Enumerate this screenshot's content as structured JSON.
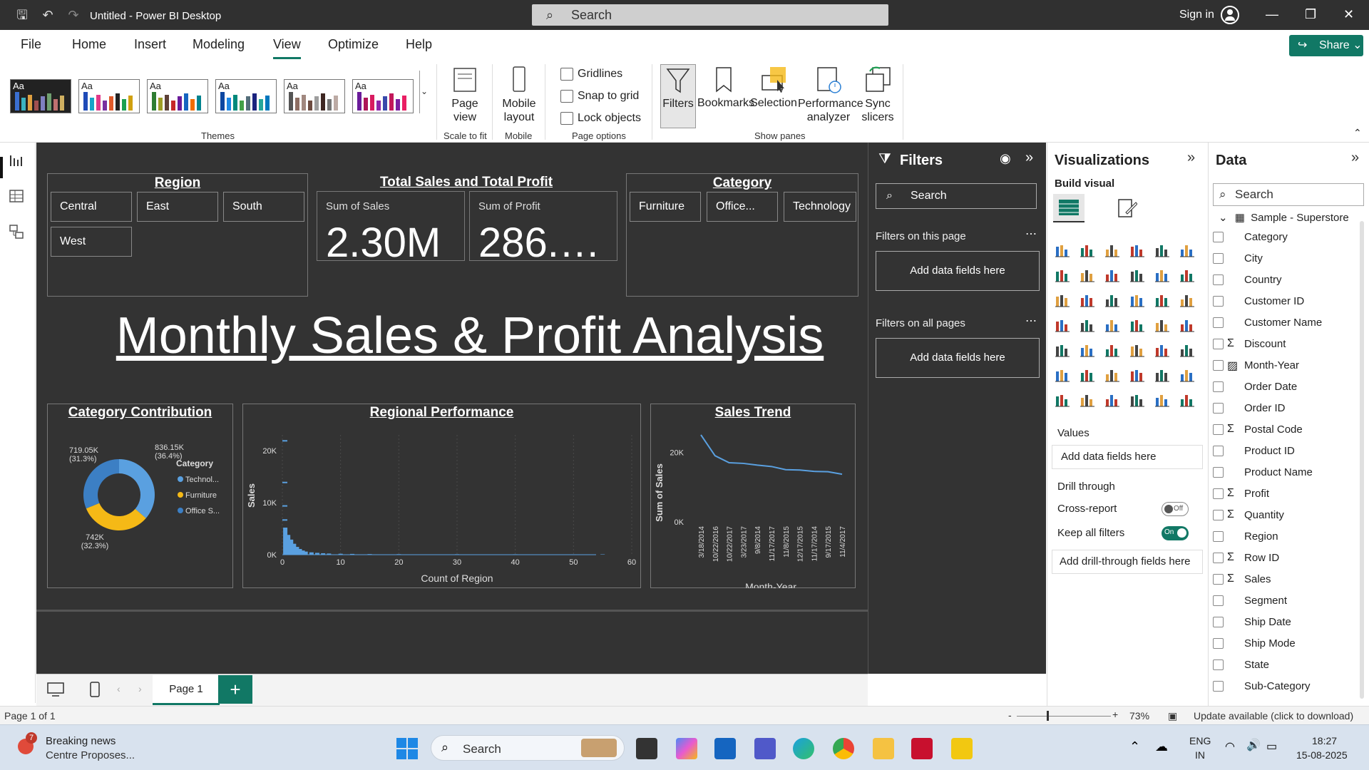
{
  "window": {
    "title": "Untitled - Power BI Desktop",
    "search_placeholder": "Search",
    "signin": "Sign in"
  },
  "menu": {
    "items": [
      "File",
      "Home",
      "Insert",
      "Modeling",
      "View",
      "Optimize",
      "Help"
    ],
    "active": "View",
    "share": "Share"
  },
  "ribbon": {
    "themes_label": "Themes",
    "theme_text": "Aa",
    "page_view": "Page view",
    "scale_label": "Scale to fit",
    "mobile_layout": "Mobile layout",
    "mobile_label": "Mobile",
    "gridlines": "Gridlines",
    "snap": "Snap to grid",
    "lock": "Lock objects",
    "page_options_label": "Page options",
    "filters": "Filters",
    "bookmarks": "Bookmarks",
    "selection": "Selection",
    "performance": "Performance analyzer",
    "sync": "Sync slicers",
    "show_panes_label": "Show panes"
  },
  "report": {
    "region_title": "Region",
    "regions": [
      "Central",
      "East",
      "South",
      "West"
    ],
    "kpi_title": "Total Sales and Total Profit",
    "kpis": [
      {
        "label": "Sum of Sales",
        "value": "2.30M"
      },
      {
        "label": "Sum of Profit",
        "value": "286.…"
      }
    ],
    "category_title": "Category",
    "categories": [
      "Furniture",
      "Office...",
      "Technology"
    ],
    "main_title": "Monthly Sales & Profit Analysis"
  },
  "chart_data": [
    {
      "type": "pie",
      "title": "Category Contribution",
      "legend_title": "Category",
      "legend": [
        "Technol...",
        "Furniture",
        "Office S..."
      ],
      "slices": [
        {
          "name": "Technology",
          "value": 836150,
          "label": "836.15K",
          "pct": "(36.4%)",
          "color": "#5aa0e0"
        },
        {
          "name": "Furniture",
          "value": 742000,
          "label": "742K",
          "pct": "(32.3%)",
          "color": "#f5b916"
        },
        {
          "name": "Office Supplies",
          "value": 719050,
          "label": "719.05K",
          "pct": "(31.3%)",
          "color": "#3c7fc4"
        }
      ]
    },
    {
      "type": "bar",
      "title": "Regional Performance",
      "xlabel": "Count of Region",
      "ylabel": "Sales",
      "xlim": [
        0,
        60
      ],
      "ylim": [
        0,
        23000
      ],
      "x_ticks": [
        "0",
        "10",
        "20",
        "30",
        "40",
        "50",
        "60"
      ],
      "y_ticks": [
        "0K",
        "10K",
        "20K"
      ],
      "x": [
        0.5,
        1,
        1.5,
        2,
        2.5,
        3,
        3.5,
        4,
        5,
        6,
        7,
        8,
        10,
        12,
        15,
        20,
        30,
        40,
        55
      ],
      "values": [
        5200,
        3800,
        2900,
        2100,
        1500,
        1100,
        800,
        600,
        450,
        350,
        280,
        220,
        180,
        150,
        120,
        100,
        90,
        80,
        70
      ],
      "outliers": [
        [
          0,
          22000
        ],
        [
          0,
          14000
        ],
        [
          0,
          9500
        ],
        [
          0,
          6800
        ]
      ]
    },
    {
      "type": "line",
      "title": "Sales Trend",
      "xlabel": "Month-Year",
      "ylabel": "Sum of Sales",
      "ylim": [
        0,
        26000
      ],
      "y_ticks": [
        "0K",
        "20K"
      ],
      "categories": [
        "3/18/2014",
        "10/22/2016",
        "10/22/2017",
        "3/23/2017",
        "9/8/2014",
        "11/17/2017",
        "11/8/2015",
        "12/17/2015",
        "11/17/2014",
        "9/17/2015",
        "11/4/2017"
      ],
      "values": [
        25000,
        19000,
        17000,
        16800,
        16300,
        15900,
        15000,
        14900,
        14500,
        14400,
        13700
      ]
    }
  ],
  "filters": {
    "title": "Filters",
    "search": "Search",
    "this_page": "Filters on this page",
    "all_pages": "Filters on all pages",
    "add": "Add data fields here"
  },
  "viz": {
    "title": "Visualizations",
    "build": "Build visual",
    "values": "Values",
    "values_drop": "Add data fields here",
    "drill": "Drill through",
    "cross": "Cross-report",
    "cross_state": "Off",
    "keep": "Keep all filters",
    "keep_state": "On",
    "drill_drop": "Add drill-through fields here"
  },
  "data": {
    "title": "Data",
    "search": "Search",
    "table": "Sample - Superstore",
    "fields": [
      {
        "name": "Category",
        "sigma": false
      },
      {
        "name": "City",
        "sigma": false
      },
      {
        "name": "Country",
        "sigma": false
      },
      {
        "name": "Customer ID",
        "sigma": false
      },
      {
        "name": "Customer Name",
        "sigma": false
      },
      {
        "name": "Discount",
        "sigma": true
      },
      {
        "name": "Month-Year",
        "sigma": false,
        "hier": true
      },
      {
        "name": "Order Date",
        "sigma": false
      },
      {
        "name": "Order ID",
        "sigma": false
      },
      {
        "name": "Postal Code",
        "sigma": true
      },
      {
        "name": "Product ID",
        "sigma": false
      },
      {
        "name": "Product Name",
        "sigma": false
      },
      {
        "name": "Profit",
        "sigma": true
      },
      {
        "name": "Quantity",
        "sigma": true
      },
      {
        "name": "Region",
        "sigma": false
      },
      {
        "name": "Row ID",
        "sigma": true
      },
      {
        "name": "Sales",
        "sigma": true
      },
      {
        "name": "Segment",
        "sigma": false
      },
      {
        "name": "Ship Date",
        "sigma": false
      },
      {
        "name": "Ship Mode",
        "sigma": false
      },
      {
        "name": "State",
        "sigma": false
      },
      {
        "name": "Sub-Category",
        "sigma": false
      }
    ]
  },
  "pages": {
    "tab": "Page 1",
    "status": "Page 1 of 1"
  },
  "status": {
    "zoom": "73%",
    "update": "Update available (click to download)"
  },
  "taskbar": {
    "news_title": "Breaking news",
    "news_sub": "Centre Proposes...",
    "news_badge": "7",
    "search": "Search",
    "lang1": "ENG",
    "lang2": "IN",
    "time": "18:27",
    "date": "15-08-2025"
  },
  "colors": {
    "accent": "#117865",
    "canvas": "#333333",
    "bar": "#5aa0e0"
  }
}
